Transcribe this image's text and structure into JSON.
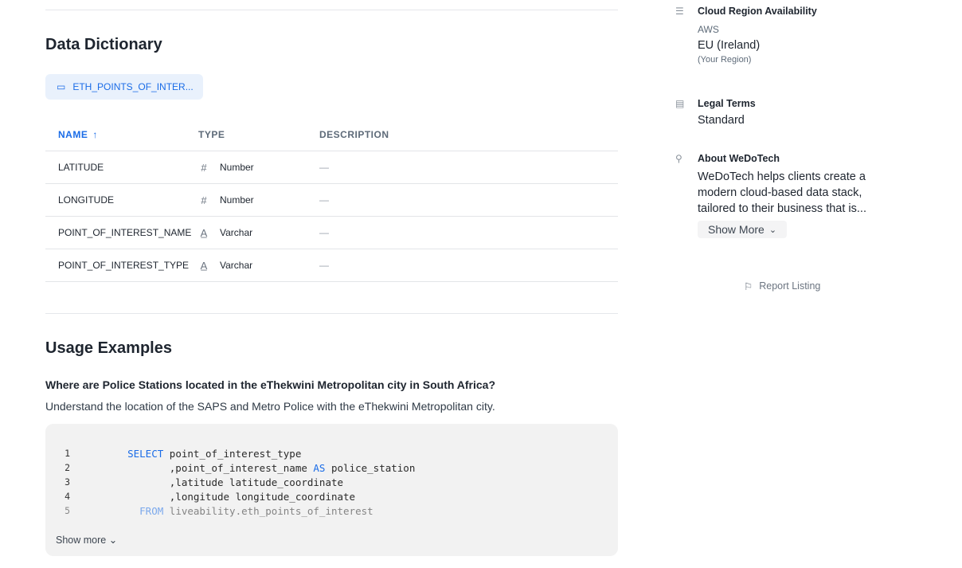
{
  "data_dictionary": {
    "title": "Data Dictionary",
    "table_chip": "ETH_POINTS_OF_INTER...",
    "columns": [
      "NAME",
      "TYPE",
      "DESCRIPTION"
    ],
    "rows": [
      {
        "name": "LATITUDE",
        "type": "Number",
        "type_icon": "hash-icon",
        "description": "—"
      },
      {
        "name": "LONGITUDE",
        "type": "Number",
        "type_icon": "hash-icon",
        "description": "—"
      },
      {
        "name": "POINT_OF_INTEREST_NAME",
        "type": "Varchar",
        "type_icon": "text-icon",
        "description": "—"
      },
      {
        "name": "POINT_OF_INTEREST_TYPE",
        "type": "Varchar",
        "type_icon": "text-icon",
        "description": "—"
      }
    ]
  },
  "usage": {
    "title": "Usage Examples",
    "question": "Where are Police Stations located in the eThekwini Metropolitan city in South Africa?",
    "description": "Understand the location of the SAPS and Metro Police with the eThekwini Metropolitan city.",
    "code": [
      {
        "n": "1",
        "kw": "SELECT",
        "rest": " point_of_interest_type",
        "indent": "    "
      },
      {
        "n": "2",
        "pre": "           ,point_of_interest_name ",
        "kw": "AS",
        "rest": " police_station"
      },
      {
        "n": "3",
        "pre": "           ,latitude latitude_coordinate"
      },
      {
        "n": "4",
        "pre": "           ,longitude longitude_coordinate"
      },
      {
        "n": "5",
        "kw": "FROM",
        "rest": " liveability.eth_points_of_interest",
        "indent": "      "
      }
    ],
    "show_more": "Show more"
  },
  "sidebar": {
    "cloud": {
      "title": "Cloud Region Availability",
      "provider": "AWS",
      "region": "EU (Ireland)",
      "note": "(Your Region)"
    },
    "legal": {
      "title": "Legal Terms",
      "value": "Standard"
    },
    "about": {
      "title": "About WeDoTech",
      "text": "WeDoTech helps clients create a modern cloud-based data stack, tailored to their business that is...",
      "show_more": "Show More"
    },
    "report": "Report Listing"
  },
  "colors": {
    "accent": "#1a6ce7",
    "code_bg": "#f2f2f2"
  }
}
